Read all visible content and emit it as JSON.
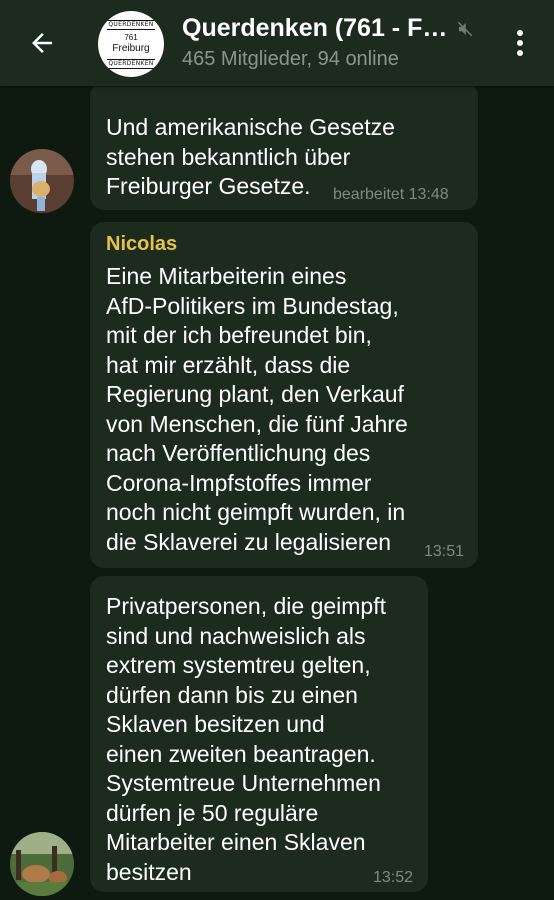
{
  "header": {
    "title": "Querdenken (761 - F…",
    "subtitle": "465 Mitglieder, 94 online",
    "avatar": {
      "top": "QUERDENKEN",
      "number": "761",
      "city": "Freiburg",
      "bottom": "QUERDENKEN"
    }
  },
  "messages": [
    {
      "text": "Und amerikanische Gesetze\nstehen bekanntlich über\nFreiburger Gesetze.",
      "time": "bearbeitet 13:48"
    },
    {
      "sender": "Nicolas",
      "text": "Eine Mitarbeiterin eines\nAfD-Politikers im Bundestag,\nmit der ich befreundet bin,\nhat mir erzählt, dass die\nRegierung plant, den Verkauf\nvon Menschen, die fünf Jahre\nnach Veröffentlichung des\nCorona-Impfstoffes immer\nnoch nicht geimpft wurden, in\ndie Sklaverei zu legalisieren",
      "time": "13:51"
    },
    {
      "text": "Privatpersonen, die geimpft\nsind und nachweislich als\nextrem systemtreu gelten,\ndürfen dann bis zu einen\nSklaven besitzen und\neinen zweiten beantragen.\nSystemtreue Unternehmen\ndürfen je 50 reguläre\nMitarbeiter einen Sklaven\nbesitzen",
      "time": "13:52"
    }
  ],
  "colors": {
    "background": "#0e1a10",
    "header": "#1d2b1f",
    "bubble": "#1d2b1f",
    "sender_name": "#e6c24a",
    "meta_text": "#8a968b"
  },
  "icons": {
    "back": "arrow-left-icon",
    "mute": "muted-speaker-icon",
    "menu": "vertical-dots-icon"
  }
}
